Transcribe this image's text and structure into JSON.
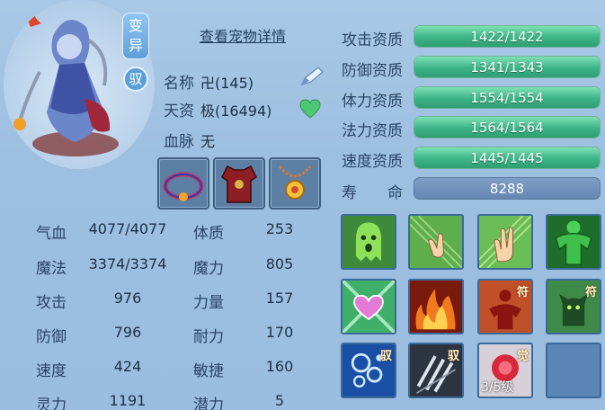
{
  "pet": {
    "badge_transform": "变异",
    "badge_control": "驭",
    "detail_link": "查看宠物详情",
    "name_label": "名称",
    "name_value": "卍(145)",
    "talent_label": "天资",
    "talent_value": "极(16494)",
    "bloodline_label": "血脉",
    "bloodline_value": "无"
  },
  "stats": [
    {
      "label": "气血",
      "value": "4077/4077",
      "label2": "体质",
      "value2": "253"
    },
    {
      "label": "魔法",
      "value": "3374/3374",
      "label2": "魔力",
      "value2": "805"
    },
    {
      "label": "攻击",
      "value": "976",
      "label2": "力量",
      "value2": "157"
    },
    {
      "label": "防御",
      "value": "796",
      "label2": "耐力",
      "value2": "170"
    },
    {
      "label": "速度",
      "value": "424",
      "label2": "敏捷",
      "value2": "160"
    },
    {
      "label": "灵力",
      "value": "1191",
      "label2": "潜力",
      "value2": "5"
    }
  ],
  "aptitudes": [
    {
      "label": "攻击资质",
      "value": "1422/1422",
      "fill": 1.0
    },
    {
      "label": "防御资质",
      "value": "1341/1343",
      "fill": 0.9985
    },
    {
      "label": "体力资质",
      "value": "1554/1554",
      "fill": 1.0
    },
    {
      "label": "法力资质",
      "value": "1564/1564",
      "fill": 1.0
    },
    {
      "label": "速度资质",
      "value": "1445/1445",
      "fill": 1.0
    }
  ],
  "lifespan": {
    "label": "寿　　命",
    "value": "8288"
  },
  "skills": [
    {
      "icon": "ghost-green-icon",
      "tag": ""
    },
    {
      "icon": "hand-gesture-icon",
      "tag": ""
    },
    {
      "icon": "open-palm-icon",
      "tag": ""
    },
    {
      "icon": "green-muscle-icon",
      "tag": ""
    },
    {
      "icon": "heart-glow-icon",
      "tag": ""
    },
    {
      "icon": "fire-icon",
      "tag": ""
    },
    {
      "icon": "red-figure-icon",
      "tag": "符"
    },
    {
      "icon": "green-cat-icon",
      "tag": "符"
    },
    {
      "icon": "bubbles-icon",
      "tag": "驭"
    },
    {
      "icon": "claws-icon",
      "tag": "驭"
    },
    {
      "icon": "awaken-icon",
      "tag": "觉",
      "level": "3/5级"
    },
    {
      "icon": "empty-slot",
      "tag": ""
    }
  ]
}
